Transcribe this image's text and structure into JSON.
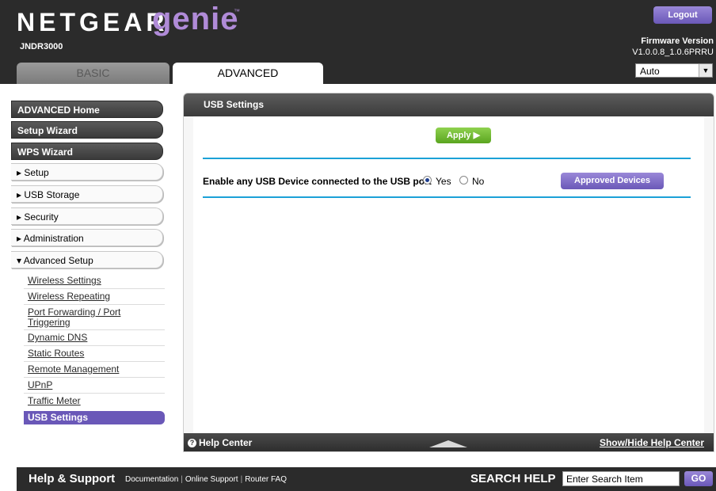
{
  "header": {
    "brand": "NETGEAR",
    "product": "genie",
    "trademark": "™",
    "model": "JNDR3000",
    "logout_label": "Logout",
    "firmware_label": "Firmware Version",
    "firmware_value": "V1.0.0.8_1.0.6PRRU",
    "tabs": [
      {
        "label": "BASIC",
        "active": false
      },
      {
        "label": "ADVANCED",
        "active": true
      }
    ],
    "language_select": {
      "value": "Auto"
    }
  },
  "sidebar": {
    "top_buttons": [
      "ADVANCED Home",
      "Setup Wizard",
      "WPS Wizard"
    ],
    "sections": [
      {
        "label": "▸ Setup"
      },
      {
        "label": "▸ USB Storage"
      },
      {
        "label": "▸ Security"
      },
      {
        "label": "▸ Administration"
      },
      {
        "label": "▾ Advanced Setup"
      }
    ],
    "advanced_setup_items": [
      "Wireless Settings",
      "Wireless Repeating",
      "Port Forwarding / Port Triggering",
      "Dynamic DNS",
      "Static Routes",
      "Remote Management",
      "UPnP",
      "Traffic Meter",
      "USB Settings"
    ],
    "active_item": "USB Settings"
  },
  "main": {
    "title": "USB Settings",
    "apply_label": "Apply ▶",
    "usb_enable_label": "Enable any USB Device connected to the USB port",
    "radio_yes": "Yes",
    "radio_no": "No",
    "selected": "Yes",
    "approved_devices_label": "Approved Devices",
    "help_center_label": "Help Center",
    "help_icon": "?",
    "show_hide_label": "Show/Hide Help Center"
  },
  "footer": {
    "title": "Help & Support",
    "links": [
      "Documentation",
      "Online Support",
      "Router FAQ"
    ],
    "search_label": "SEARCH HELP",
    "search_placeholder": "Enter Search Item",
    "go_label": "GO"
  },
  "colors": {
    "accent_purple": "#6a58b8",
    "apply_green": "#5aa51f",
    "divider_blue": "#1ba1d7",
    "header_dark": "#2b2b2b"
  }
}
